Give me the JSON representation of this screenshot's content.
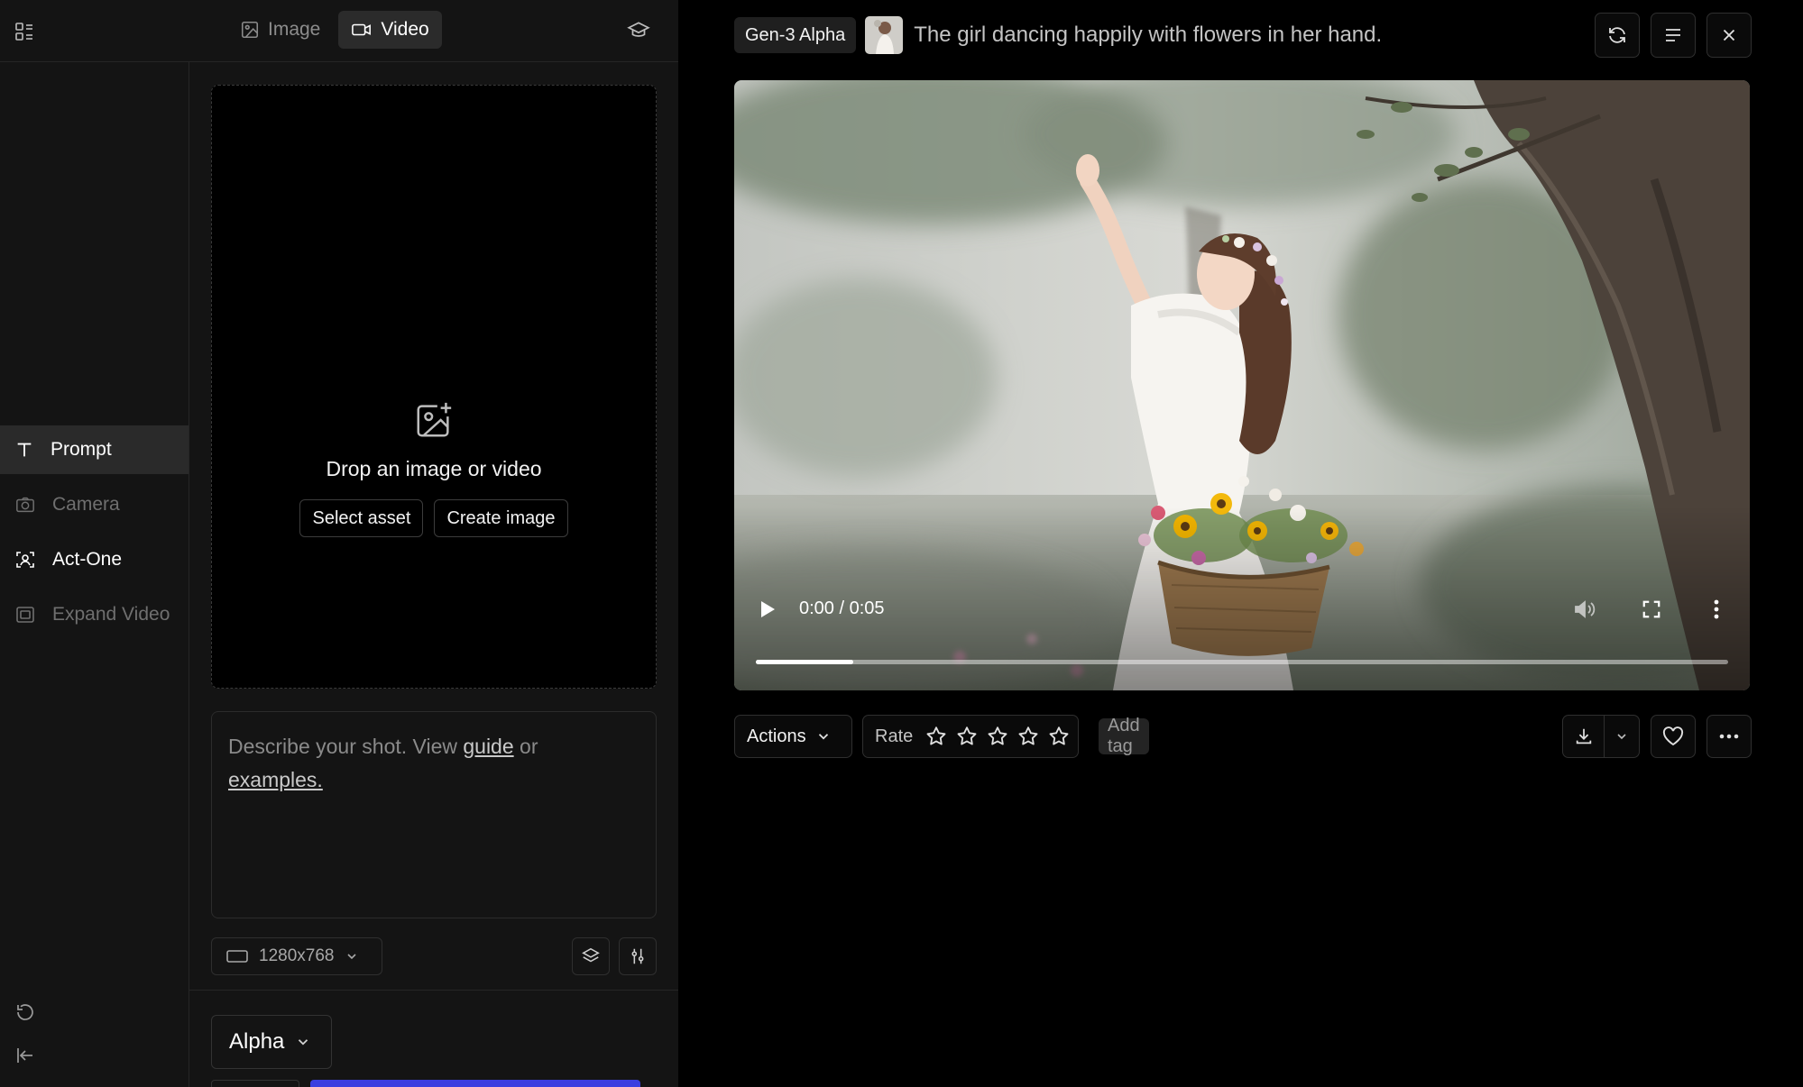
{
  "top": {
    "tabs": [
      {
        "label": "Image",
        "icon": "image-icon"
      },
      {
        "label": "Video",
        "icon": "video-camera-icon"
      }
    ]
  },
  "sidebar": {
    "items": [
      {
        "label": "Prompt",
        "icon": "text-t-icon"
      },
      {
        "label": "Camera",
        "icon": "camera-icon"
      },
      {
        "label": "Act-One",
        "icon": "face-scan-icon"
      },
      {
        "label": "Expand Video",
        "icon": "expand-frame-icon"
      }
    ]
  },
  "dropzone": {
    "title": "Drop an image or video",
    "select_label": "Select asset",
    "create_label": "Create image"
  },
  "prompt": {
    "lead": "Describe your shot. View ",
    "guide_link": "guide",
    "or_text": " or ",
    "examples_link": "examples."
  },
  "settings": {
    "resolution": "1280x768",
    "model": "Alpha"
  },
  "output": {
    "model_badge": "Gen-3 Alpha",
    "title": "The girl dancing happily with flowers in her hand.",
    "time": "0:00 / 0:05",
    "progress": 0.1
  },
  "actions": {
    "actions_label": "Actions",
    "rate_label": "Rate",
    "stars_total": 5,
    "stars_filled": 0,
    "add_tag_label": "Add tag"
  },
  "colors": {
    "panel_bg": "#141414",
    "accent_blue": "#3b3fe0"
  }
}
